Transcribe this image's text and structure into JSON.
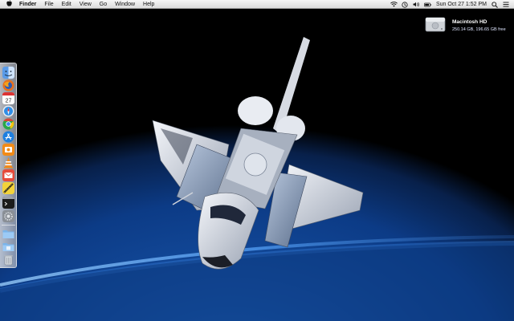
{
  "menubar": {
    "apple_icon": "apple-icon",
    "app_name": "Finder",
    "menus": [
      "File",
      "Edit",
      "View",
      "Go",
      "Window",
      "Help"
    ],
    "status_icons": [
      "wifi-icon",
      "volume-icon",
      "battery-icon"
    ],
    "clock": "Sun Oct 27  1:52 PM",
    "search_icon": "spotlight-search-icon",
    "notification_icon": "notification-center-icon"
  },
  "desktop": {
    "drive_name": "Macintosh HD",
    "drive_info": "250.14 GB, 196.65 GB free"
  },
  "dock": {
    "items": [
      "finder-icon",
      "firefox-icon",
      "calendar-icon",
      "safari-icon",
      "chrome-icon",
      "app-store-icon",
      "vlc-icon",
      "photobooth-icon",
      "mail-icon",
      "maps-icon",
      "terminal-icon",
      "system-preferences-icon",
      "applications-folder-icon",
      "documents-folder-icon",
      "trash-icon"
    ],
    "calendar_day": "27"
  }
}
